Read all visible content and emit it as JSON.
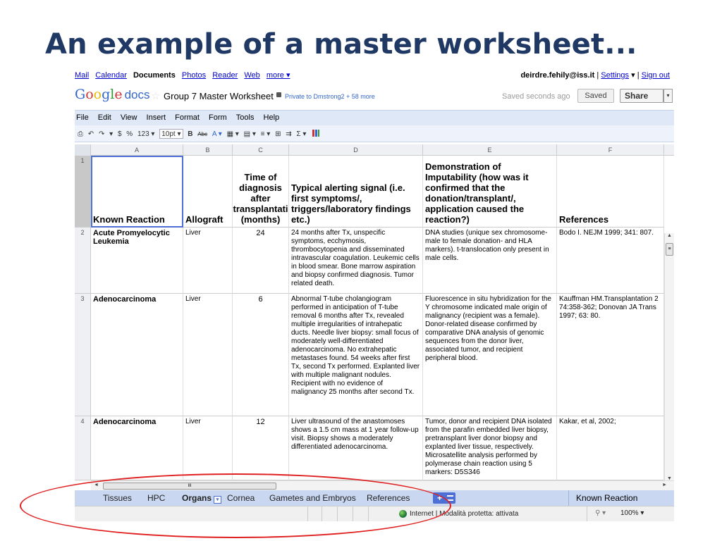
{
  "slide": {
    "title": "An example of a master worksheet..."
  },
  "topbar": {
    "links": [
      "Mail",
      "Calendar",
      "Documents",
      "Photos",
      "Reader",
      "Web",
      "more ▾"
    ],
    "email": "deirdre.fehily@iss.it",
    "settings": "Settings",
    "settings_arrow": "▾",
    "signout": "Sign out",
    "sep": "|"
  },
  "docbar": {
    "logo_letters": [
      "G",
      "o",
      "o",
      "g",
      "l",
      "e"
    ],
    "logo_docs": "docs",
    "star": "☆",
    "doc_title": "Group 7 Master Worksheet",
    "private_text": "Private to Dmstrong2 + 58 more",
    "saved_status": "Saved seconds ago",
    "saved_button": "Saved",
    "share_button": "Share",
    "share_arrow": "▾"
  },
  "menu": [
    "File",
    "Edit",
    "View",
    "Insert",
    "Format",
    "Form",
    "Tools",
    "Help"
  ],
  "toolbar": {
    "items": [
      "⎙",
      "↶",
      "↷",
      "▾",
      "$",
      "%",
      "123 ▾",
      "10pt ▾",
      "B",
      "Abc",
      "A ▾",
      "▦ ▾",
      "▤ ▾",
      "≡ ▾",
      "⊞",
      "⇉",
      "Σ ▾"
    ]
  },
  "columns": [
    "A",
    "B",
    "C",
    "D",
    "E",
    "F"
  ],
  "rows": [
    {
      "num": "1",
      "cells": [
        "Known Reaction",
        "Allograft",
        "Time of diagnosis after transplantati (months)",
        "Typical alerting signal (i.e. first symptoms/, triggers/laboratory findings etc.)",
        "Demonstration of Imputability (how was it confirmed that the donation/transplant/, application caused the reaction?)",
        "References"
      ]
    },
    {
      "num": "2",
      "cells": [
        "Acute Promyelocytic Leukemia",
        "Liver",
        "24",
        "24 months after Tx, unspecific symptoms, ecchymosis, thrombocytopenia and disseminated intravascular coagulation. Leukemic cells in blood smear. Bone marrow aspiration and biopsy confirmed diagnosis. Tumor related death.",
        "DNA studies (unique sex chromosome- male to female donation- and HLA markers). t-translocation only present in male cells.",
        "Bodo I. NEJM 1999; 341: 807."
      ]
    },
    {
      "num": "3",
      "cells": [
        "Adenocarcinoma",
        "Liver",
        "6",
        "Abnormal T-tube cholangiogram performed in anticipation of T-tube removal 6 months after Tx, revealed multiple irregularities of intrahepatic ducts. Needle liver biopsy: small focus of moderately well-differentiated adenocarcinoma. No extrahepatic metastases found. 54 weeks after first Tx, second Tx performed. Explanted liver with multiple malignant nodules. Recipient with no evidence of malignancy 25 months after second Tx.",
        "Fluorescence in situ hybridization for the Y chromosome indicated male origin of malignancy (recipient was a female). Donor-related disease confirmed by comparative DNA analysis of genomic sequences from the donor liver, associated tumor, and recipient peripheral blood.",
        "Kauffman HM.Transplantation 2 74:358-362; Donovan JA Trans 1997; 63: 80."
      ]
    },
    {
      "num": "4",
      "cells": [
        "Adenocarcinoma",
        "Liver",
        "12",
        "Liver ultrasound of the anastomoses shows a 1.5 cm mass at 1 year follow-up visit. Biopsy shows a moderately differentiated adenocarcinoma.",
        "Tumor, donor and recipient DNA isolated from the parafin embedded liver biopsy, pretransplant liver donor biopsy and explanted liver tissue, respectively. Microsatellite analysis performed by polymerase chain reaction using 5 markers: D5S346",
        "Kakar, et al, 2002;"
      ]
    }
  ],
  "scroll": {
    "up": "▲",
    "down": "▼",
    "left": "◄",
    "right": "►",
    "grip": "≡",
    "hgrip": "III"
  },
  "sheets": {
    "tabs": [
      "Tissues",
      "HPC",
      "Organs",
      "Cornea",
      "Gametes and Embryos",
      "References"
    ],
    "active": "Organs",
    "active_drop": "▾",
    "add": "+",
    "active_range_label": "Known Reaction"
  },
  "statusbar": {
    "ie_status": "Internet | Modalità protetta: attivata",
    "zoom_icon": "⚲ ▾",
    "zoom": "100%",
    "zoom_arrow": "▾"
  },
  "colors": {
    "title": "#1f3864",
    "oval": "#e02020",
    "tabbar": "#c9d7f1",
    "menubar": "#dfe8f6"
  }
}
